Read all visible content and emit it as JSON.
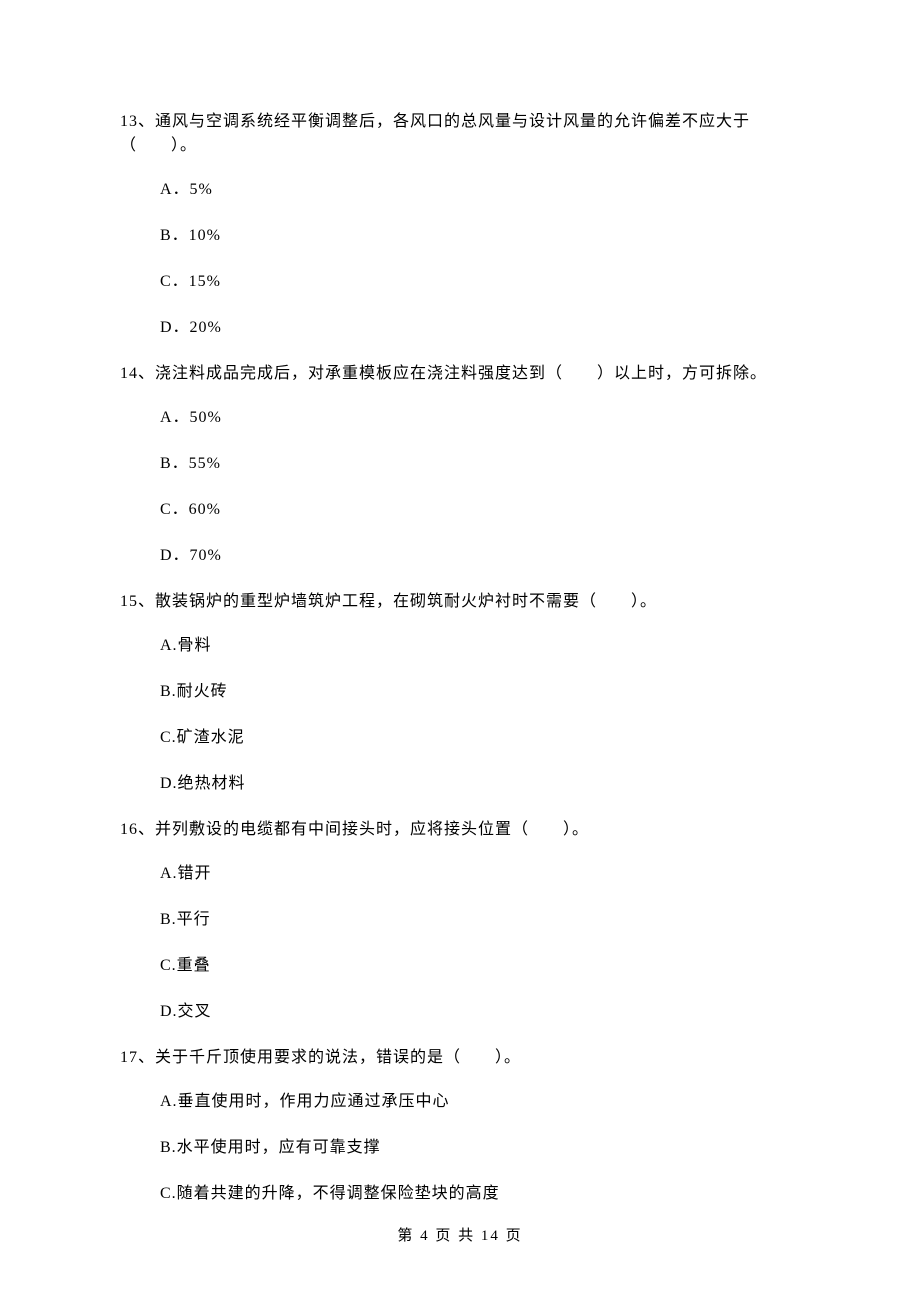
{
  "questions": [
    {
      "number": "13、",
      "text": "通风与空调系统经平衡调整后，各风口的总风量与设计风量的允许偏差不应大于（　　）。",
      "options": [
        "A．5%",
        "B．10%",
        "C．15%",
        "D．20%"
      ]
    },
    {
      "number": "14、",
      "text": "浇注料成品完成后，对承重模板应在浇注料强度达到（　　）以上时，方可拆除。",
      "options": [
        "A．50%",
        "B．55%",
        "C．60%",
        "D．70%"
      ]
    },
    {
      "number": "15、",
      "text": "散装锅炉的重型炉墙筑炉工程，在砌筑耐火炉衬时不需要（　　）。",
      "options": [
        "A.骨料",
        "B.耐火砖",
        "C.矿渣水泥",
        "D.绝热材料"
      ]
    },
    {
      "number": "16、",
      "text": "并列敷设的电缆都有中间接头时，应将接头位置（　　）。",
      "options": [
        "A.错开",
        "B.平行",
        "C.重叠",
        "D.交叉"
      ]
    },
    {
      "number": "17、",
      "text": "关于千斤顶使用要求的说法，错误的是（　　）。",
      "options": [
        "A.垂直使用时，作用力应通过承压中心",
        "B.水平使用时，应有可靠支撑",
        "C.随着共建的升降，不得调整保险垫块的高度"
      ]
    }
  ],
  "footer": "第 4 页 共 14 页"
}
